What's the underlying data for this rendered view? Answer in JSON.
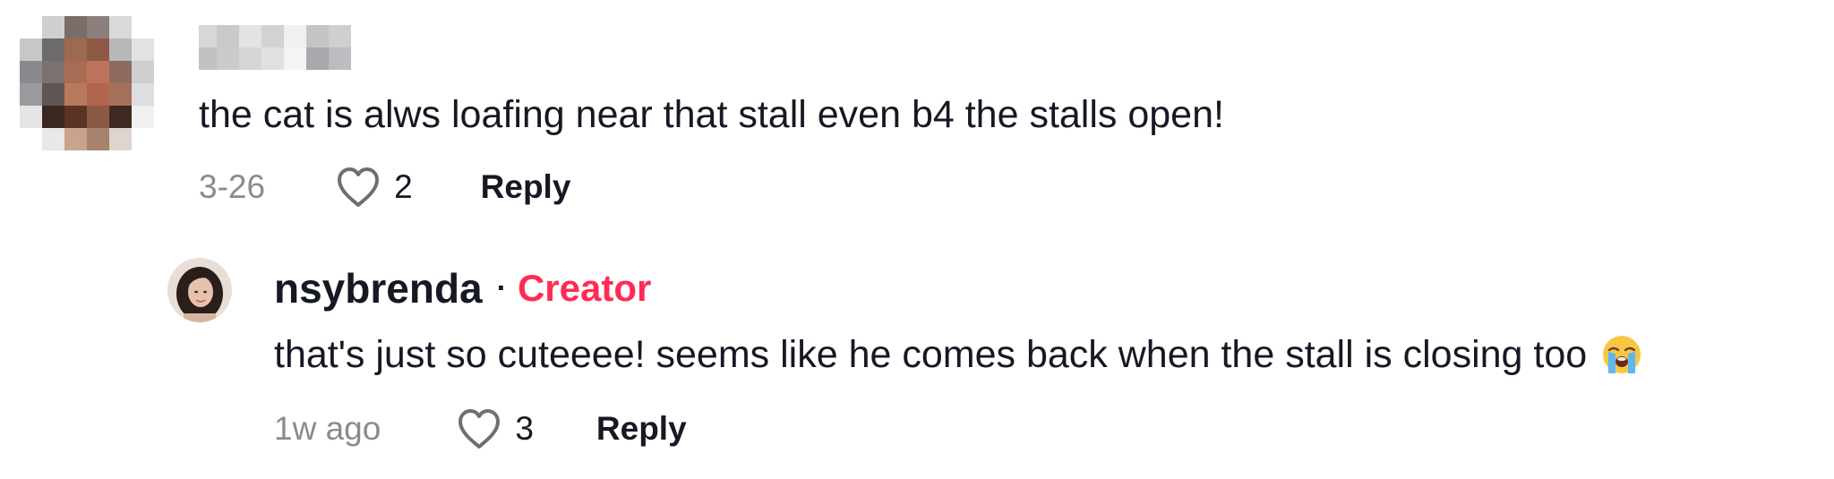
{
  "comment": {
    "avatar_icon": "pixelated-avatar-icon",
    "username_redacted": true,
    "text": "the cat is alws loafing near that stall even b4 the stalls open!",
    "timestamp": "3-26",
    "like_icon": "heart-outline-icon",
    "like_count": "2",
    "reply_label": "Reply"
  },
  "reply": {
    "avatar_icon": "profile-photo-icon",
    "username": "nsybrenda",
    "separator": "·",
    "badge": "Creator",
    "text": "that's just so cuteeee! seems like he comes back when the stall is closing too",
    "emoji_icon": "loudly-crying-face-icon",
    "timestamp": "1w ago",
    "like_icon": "heart-outline-icon",
    "like_count": "3",
    "reply_label": "Reply"
  },
  "colors": {
    "text_primary": "#161823",
    "text_secondary": "#8a8b91",
    "creator_accent": "#fe2c55"
  }
}
